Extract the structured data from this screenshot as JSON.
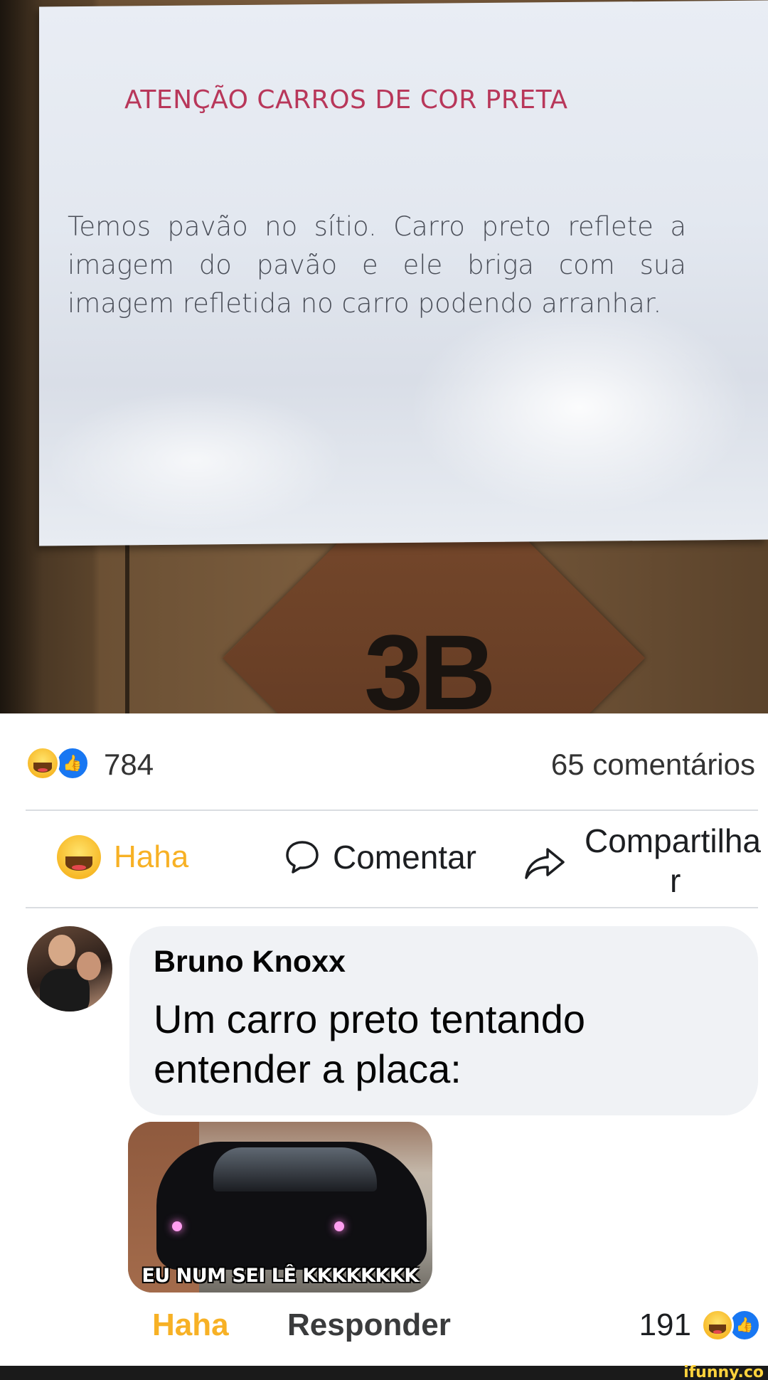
{
  "post_image": {
    "sign_title": "ATENÇÃO CARROS DE COR PRETA",
    "sign_body": "Temos pavão no sítio. Carro preto reflete a imagem do pavão e ele briga com sua imagem refletida no carro podendo arranhar.",
    "plate_number": "3B"
  },
  "reactions_summary": {
    "icons": [
      "haha-icon",
      "like-icon"
    ],
    "count": "784",
    "comments": "65 comentários"
  },
  "actions": {
    "haha_label": "Haha",
    "comment_label": "Comentar",
    "share_label_line1": "Compartilha",
    "share_label_line2": "r"
  },
  "comment": {
    "author": "Bruno Knoxx",
    "text": "Um carro preto tentando entender a placa:",
    "meme_caption": "EU NUM SEI LÊ KKKKKKKK",
    "haha_label": "Haha",
    "reply_label": "Responder",
    "reaction_count": "191"
  },
  "watermark": "ifunny.co",
  "colors": {
    "haha": "#f7b125",
    "like": "#1877f2",
    "bubble": "#f0f2f5",
    "divider": "#dadde1"
  }
}
